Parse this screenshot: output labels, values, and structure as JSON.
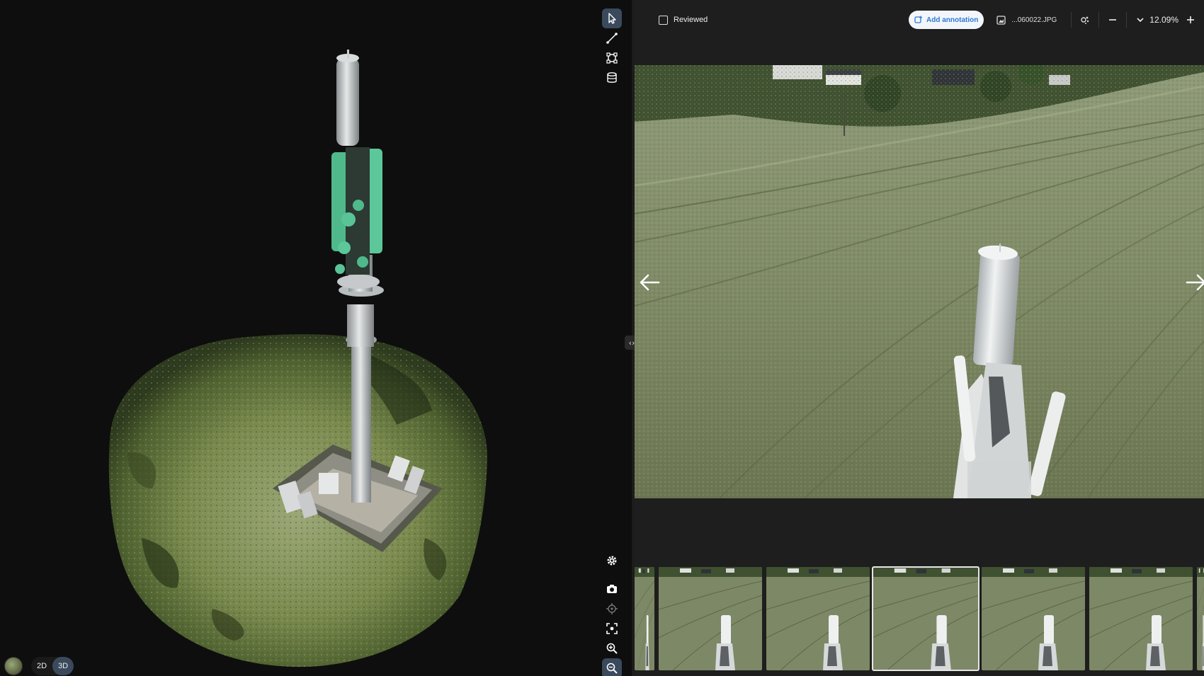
{
  "toolbar": {
    "reviewed_label": "Reviewed",
    "add_annotation_label": "Add annotation",
    "file_name": "...060022.JPG",
    "zoom_level": "12.09%"
  },
  "view_mode": {
    "options": [
      "2D",
      "3D"
    ],
    "selected": "3D"
  },
  "tools_top": [
    "select-tool",
    "line-tool",
    "polygon-tool",
    "volume-tool"
  ],
  "tools_bottom": [
    "settings",
    "screenshot",
    "locate",
    "focus",
    "zoom-in",
    "zoom-out"
  ],
  "colors": {
    "accent": "#3a4a5c",
    "annotation_blue": "#2f79d4",
    "panel_bg": "#1e1e1e",
    "viewer_bg": "#0e0e0e"
  },
  "filmstrip": {
    "count": 6,
    "selected_index": 3
  }
}
